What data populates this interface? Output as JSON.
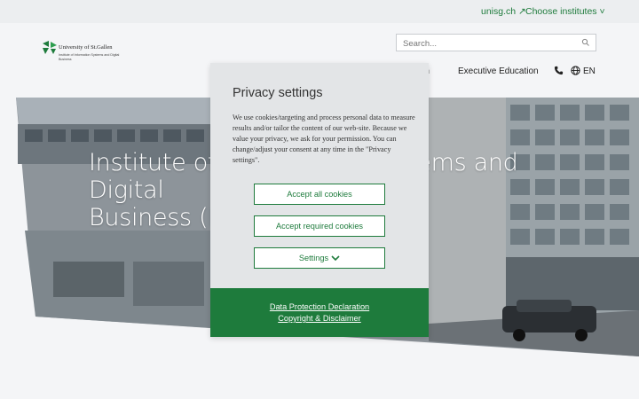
{
  "topbar": {
    "unisg_link": "unisg.ch ↗",
    "institutes_dropdown": "Choose institutes ˅"
  },
  "header": {
    "logo_name": "University of St.Gallen",
    "logo_sub": "Institute of Information Systems and Digital Business",
    "search_placeholder": "Search...",
    "nav_partial": "rch",
    "nav_exec": "Executive Education",
    "lang": "EN"
  },
  "hero": {
    "title_line1": "Institute of Information Systems and Digital",
    "title_line2": "Business (IWI-HSG)"
  },
  "privacy": {
    "title": "Privacy settings",
    "body": "We use cookies/targeting and process personal data to measure results and/or tailor the content of our web-site. Because we value your privacy, we ask for your permission. You can change/adjust your consent at any time in the \"Privacy settings\".",
    "accept_all": "Accept all cookies",
    "accept_required": "Accept required cookies",
    "settings": "Settings",
    "data_protection": "Data Protection Declaration",
    "copyright": "Copyright & Disclaimer"
  },
  "colors": {
    "brand_green": "#1e7b3c",
    "modal_bg": "#e3e5e7",
    "page_bg": "#f4f5f7"
  }
}
